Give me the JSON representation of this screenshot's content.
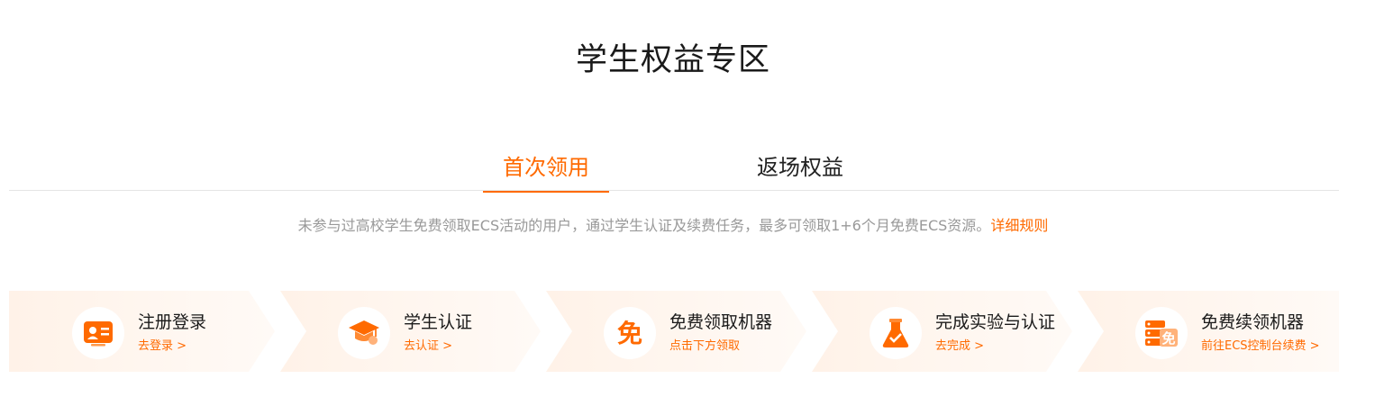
{
  "page": {
    "title": "学生权益专区"
  },
  "tabs": [
    {
      "label": "首次领用",
      "active": true
    },
    {
      "label": "返场权益",
      "active": false
    }
  ],
  "description": {
    "text": "未参与过高校学生免费领取ECS活动的用户，通过学生认证及续费任务，最多可领取1+6个月免费ECS资源。",
    "link": "详细规则"
  },
  "steps": [
    {
      "title": "注册登录",
      "link": "去登录 >",
      "icon": "id-card-icon"
    },
    {
      "title": "学生认证",
      "link": "去认证 >",
      "icon": "graduation-cap-icon"
    },
    {
      "title": "免费领取机器",
      "link": "点击下方领取",
      "icon": "free-badge-icon"
    },
    {
      "title": "完成实验与认证",
      "link": "去完成 >",
      "icon": "flask-icon"
    },
    {
      "title": "免费续领机器",
      "link": "前往ECS控制台续费 >",
      "icon": "server-free-icon"
    }
  ],
  "colors": {
    "accent": "#ff6a00",
    "step_bg_start": "#fff2e8",
    "step_bg_end": "#ffffff"
  }
}
